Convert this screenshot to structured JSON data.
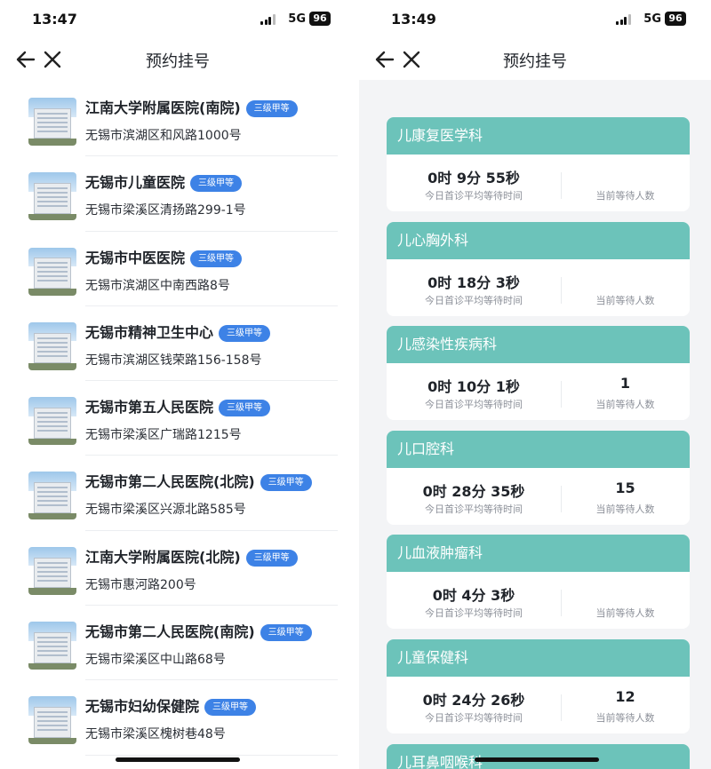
{
  "left": {
    "status": {
      "time": "13:47",
      "network": "5G",
      "battery": "96"
    },
    "title": "预约挂号",
    "hospitals": [
      {
        "name": "江南大学附属医院(南院)",
        "level": "三级甲等",
        "address": "无锡市滨湖区和风路1000号"
      },
      {
        "name": "无锡市儿童医院",
        "level": "三级甲等",
        "address": "无锡市梁溪区清扬路299-1号"
      },
      {
        "name": "无锡市中医医院",
        "level": "三级甲等",
        "address": "无锡市滨湖区中南西路8号"
      },
      {
        "name": "无锡市精神卫生中心",
        "level": "三级甲等",
        "address": "无锡市滨湖区钱荣路156-158号"
      },
      {
        "name": "无锡市第五人民医院",
        "level": "三级甲等",
        "address": "无锡市梁溪区广瑞路1215号"
      },
      {
        "name": "无锡市第二人民医院(北院)",
        "level": "三级甲等",
        "address": "无锡市梁溪区兴源北路585号"
      },
      {
        "name": "江南大学附属医院(北院)",
        "level": "三级甲等",
        "address": "无锡市惠河路200号"
      },
      {
        "name": "无锡市第二人民医院(南院)",
        "level": "三级甲等",
        "address": "无锡市梁溪区中山路68号"
      },
      {
        "name": "无锡市妇幼保健院",
        "level": "三级甲等",
        "address": "无锡市梁溪区槐树巷48号"
      }
    ]
  },
  "right": {
    "status": {
      "time": "13:49",
      "network": "5G",
      "battery": "96"
    },
    "title": "预约挂号",
    "wait_caption": "今日首诊平均等待时间",
    "count_caption": "当前等待人数",
    "departments": [
      {
        "name": "儿康复医学科",
        "wait": "0时 9分 55秒",
        "count": ""
      },
      {
        "name": "儿心胸外科",
        "wait": "0时 18分 3秒",
        "count": ""
      },
      {
        "name": "儿感染性疾病科",
        "wait": "0时 10分 1秒",
        "count": "1"
      },
      {
        "name": "儿口腔科",
        "wait": "0时 28分 35秒",
        "count": "15"
      },
      {
        "name": "儿血液肿瘤科",
        "wait": "0时 4分 3秒",
        "count": ""
      },
      {
        "name": "儿童保健科",
        "wait": "0时 24分 26秒",
        "count": "12"
      }
    ],
    "partial_department": "儿耳鼻咽喉科"
  },
  "colors": {
    "accent_teal": "#6cc3ba",
    "badge_blue": "#3d82e6"
  },
  "icons": [
    "back-arrow-icon",
    "close-icon",
    "signal-icon",
    "battery-icon"
  ]
}
